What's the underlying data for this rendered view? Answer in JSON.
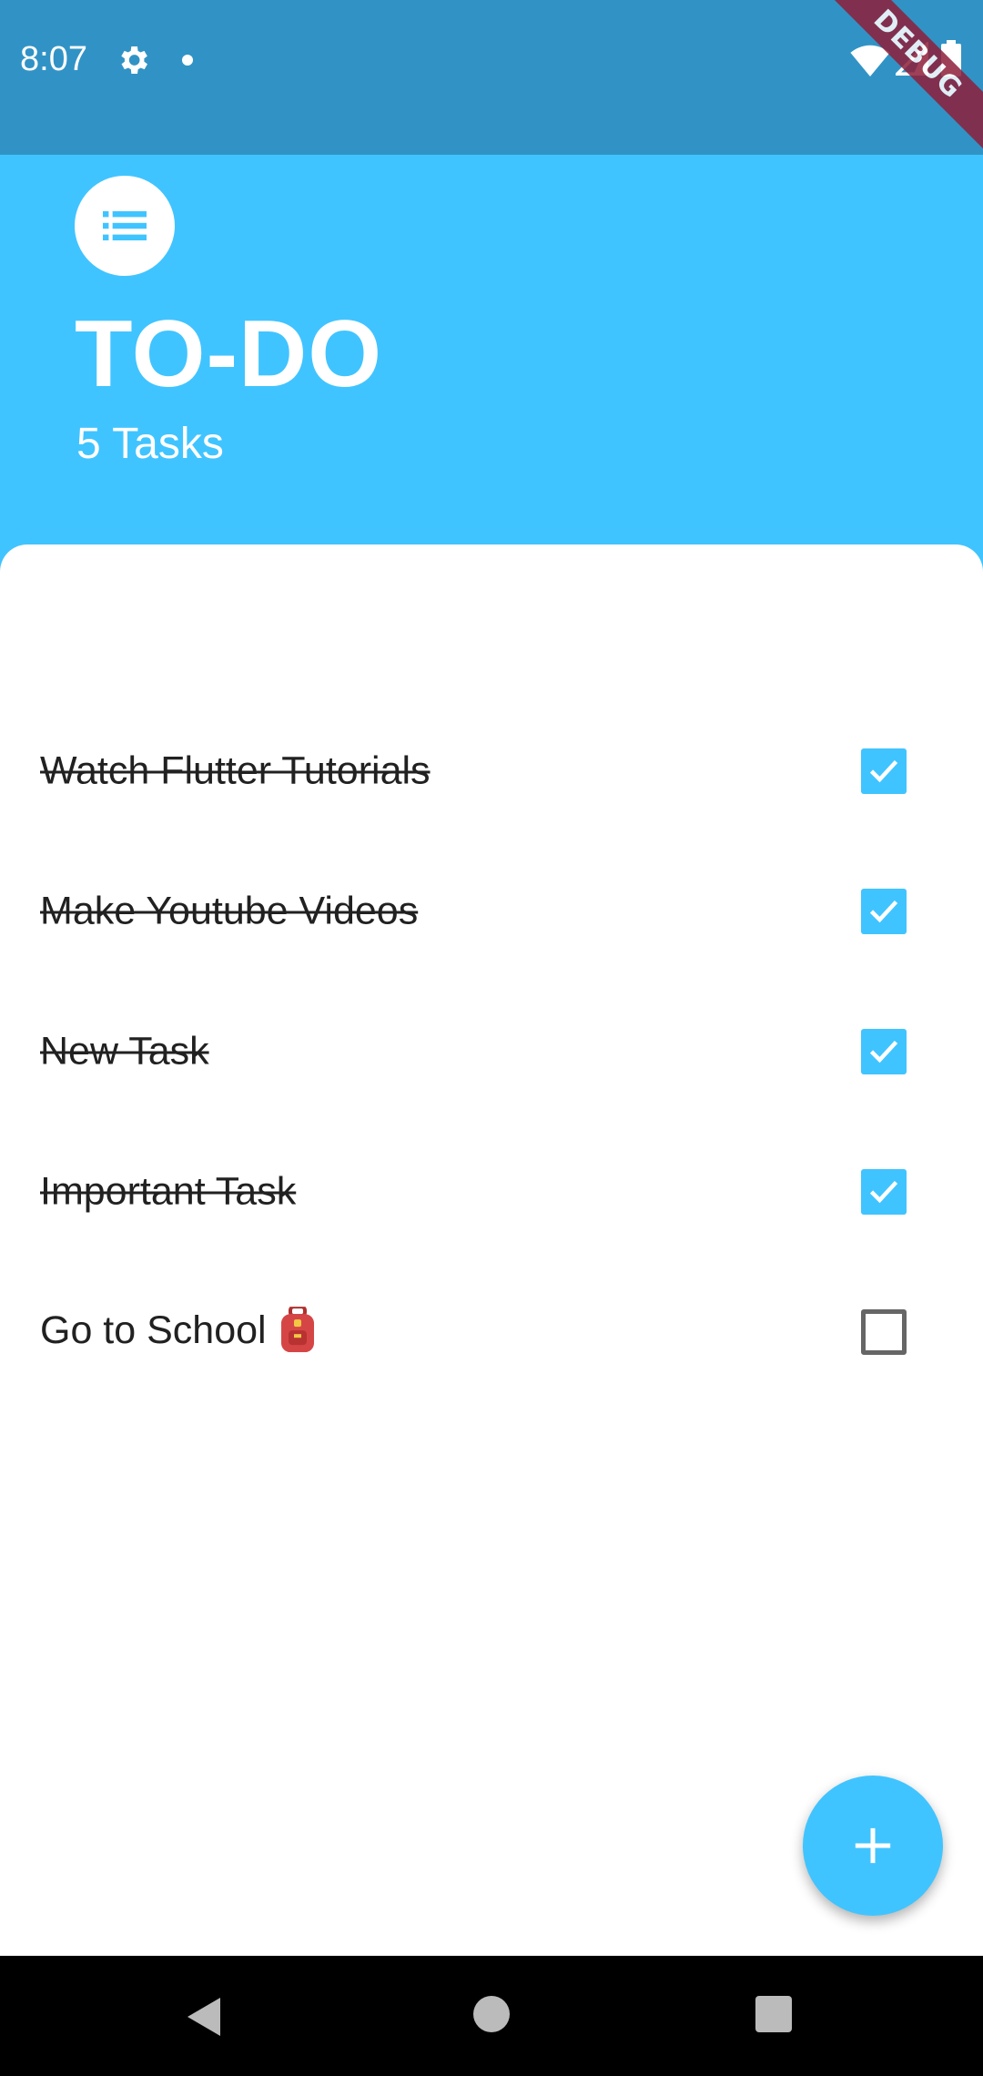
{
  "status_bar": {
    "time": "8:07",
    "icons": [
      "settings-icon",
      "notification-dot-icon",
      "wifi-icon",
      "signal-icon",
      "battery-icon"
    ]
  },
  "debug_banner": {
    "label": "DEBUG"
  },
  "header": {
    "icon": "list-icon",
    "title": "TO-DO",
    "task_count": "5 Tasks"
  },
  "tasks": [
    {
      "label": "Watch Flutter Tutorials",
      "done": true
    },
    {
      "label": "Make Youtube Videos",
      "done": true
    },
    {
      "label": "New Task ",
      "done": true
    },
    {
      "label": "Important Task",
      "done": true
    },
    {
      "label": "Go to School",
      "done": false,
      "emoji_icon": "backpack-icon"
    }
  ],
  "fab": {
    "icon": "plus-icon"
  },
  "nav_bar": {
    "icons": [
      "back-icon",
      "home-icon",
      "recents-icon"
    ]
  },
  "colors": {
    "primary": "#40C4FF",
    "status_bar": "#3193C5",
    "text": "#212121",
    "debug_banner": "#8E1F3A"
  }
}
